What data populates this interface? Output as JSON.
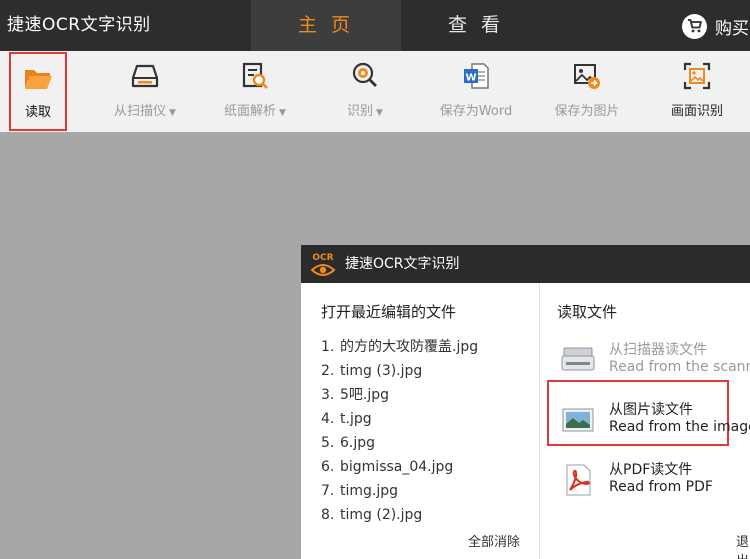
{
  "app": {
    "title": "捷速OCR文字识别"
  },
  "tabs": {
    "home": "主 页",
    "view": "查 看"
  },
  "buy": {
    "label": "购买"
  },
  "toolbar": {
    "open": "读取",
    "scanner": "从扫描仪",
    "paper": "纸面解析",
    "recognize": "识别",
    "save_word": "保存为Word",
    "save_image": "保存为图片",
    "screen": "画面识别",
    "dropdown_arrow": "▼"
  },
  "dialog": {
    "title": "捷速OCR文字识别",
    "logo_text": "OCR",
    "recent": {
      "heading": "打开最近编辑的文件",
      "files": [
        {
          "num": "1.",
          "name": "的方的大攻防覆盖.jpg"
        },
        {
          "num": "2.",
          "name": "timg (3).jpg"
        },
        {
          "num": "3.",
          "name": "5吧.jpg"
        },
        {
          "num": "4.",
          "name": "t.jpg"
        },
        {
          "num": "5.",
          "name": "6.jpg"
        },
        {
          "num": "6.",
          "name": "bigmissa_04.jpg"
        },
        {
          "num": "7.",
          "name": "timg.jpg"
        },
        {
          "num": "8.",
          "name": "timg (2).jpg"
        }
      ],
      "clear_all": "全部消除"
    },
    "read": {
      "heading": "读取文件",
      "scanner": {
        "cn": "从扫描器读文件",
        "en": "Read from the scanner"
      },
      "image": {
        "cn": "从图片读文件",
        "en": "Read from the image"
      },
      "pdf": {
        "cn": "从PDF读文件",
        "en": "Read from PDF"
      },
      "exit": "退出"
    }
  },
  "colors": {
    "accent": "#f08a1c",
    "highlight": "#e0383b",
    "titlebar": "#2d2d2d",
    "toolbar": "#f1f1f1",
    "backdrop": "#a7a7a7"
  }
}
